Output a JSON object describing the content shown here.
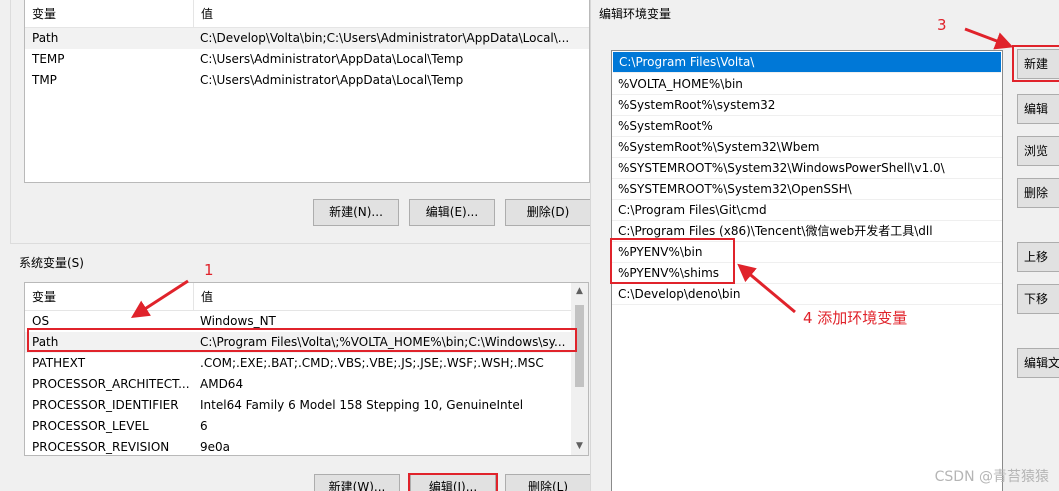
{
  "env_dialog": {
    "user_vars": {
      "header": {
        "name": "变量",
        "value": "值"
      },
      "rows": [
        {
          "name": "Path",
          "value": "C:\\Develop\\Volta\\bin;C:\\Users\\Administrator\\AppData\\Local\\..."
        },
        {
          "name": "TEMP",
          "value": "C:\\Users\\Administrator\\AppData\\Local\\Temp"
        },
        {
          "name": "TMP",
          "value": "C:\\Users\\Administrator\\AppData\\Local\\Temp"
        }
      ],
      "buttons": {
        "new": "新建(N)...",
        "edit": "编辑(E)...",
        "delete": "删除(D)"
      }
    },
    "system_vars": {
      "group_label": "系统变量(S)",
      "header": {
        "name": "变量",
        "value": "值"
      },
      "rows": [
        {
          "name": "OS",
          "value": "Windows_NT"
        },
        {
          "name": "Path",
          "value": "C:\\Program Files\\Volta\\;%VOLTA_HOME%\\bin;C:\\Windows\\sy..."
        },
        {
          "name": "PATHEXT",
          "value": ".COM;.EXE;.BAT;.CMD;.VBS;.VBE;.JS;.JSE;.WSF;.WSH;.MSC"
        },
        {
          "name": "PROCESSOR_ARCHITECT...",
          "value": "AMD64"
        },
        {
          "name": "PROCESSOR_IDENTIFIER",
          "value": "Intel64 Family 6 Model 158 Stepping 10, GenuineIntel"
        },
        {
          "name": "PROCESSOR_LEVEL",
          "value": "6"
        },
        {
          "name": "PROCESSOR_REVISION",
          "value": "9e0a"
        }
      ],
      "buttons": {
        "new": "新建(W)...",
        "edit": "编辑(I)...",
        "delete": "删除(L)"
      }
    }
  },
  "edit_dialog": {
    "title": "编辑环境变量",
    "paths": [
      "C:\\Program Files\\Volta\\",
      "%VOLTA_HOME%\\bin",
      "%SystemRoot%\\system32",
      "%SystemRoot%",
      "%SystemRoot%\\System32\\Wbem",
      "%SYSTEMROOT%\\System32\\WindowsPowerShell\\v1.0\\",
      "%SYSTEMROOT%\\System32\\OpenSSH\\",
      "C:\\Program Files\\Git\\cmd",
      "C:\\Program Files (x86)\\Tencent\\微信web开发者工具\\dll",
      "%PYENV%\\bin",
      "%PYENV%\\shims",
      "C:\\Develop\\deno\\bin"
    ],
    "buttons": {
      "new": "新建",
      "edit": "编辑",
      "browse": "浏览",
      "delete": "删除",
      "up": "上移",
      "down": "下移",
      "edit_text": "编辑文"
    }
  },
  "annotations": {
    "a1": "1",
    "a3": "3",
    "a4": "4 添加环境变量"
  },
  "watermark": "CSDN @青苔猿猿",
  "colors": {
    "annotation": "#e0232b",
    "selection": "#0078d7"
  }
}
